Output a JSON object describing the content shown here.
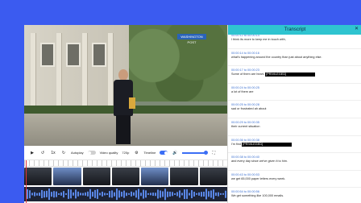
{
  "video": {
    "logo_text": "WASHINGTON POST"
  },
  "controls": {
    "speed": "1x",
    "autoplay_label": "Autoplay",
    "quality_label": "Video quality",
    "quality_value": "720p",
    "timeline_label": "Timeline"
  },
  "transcript": {
    "title": "Transcript",
    "segments": [
      {
        "time": "00:00:12 to 00:00:14",
        "text": "I think its more to keep me in touch with,",
        "privileged": ""
      },
      {
        "time": "00:00:14 to 00:00:16",
        "text": "what's happening around the country than just about anything else.",
        "privileged": ""
      },
      {
        "time": "00:00:17 to 00:00:23",
        "text": "Some of them are heart-",
        "privileged": "[PRIVILEGED]"
      },
      {
        "time": "00:00:24 to 00:00:25",
        "text": "a lot of them are",
        "privileged": ""
      },
      {
        "time": "00:00:25 to 00:00:28",
        "text": "sad or frustrated ah about",
        "privileged": ""
      },
      {
        "time": "00:00:29 to 00:00:35",
        "text": "their current situation",
        "privileged": ""
      },
      {
        "time": "00:00:36 to 00:00:38",
        "text": "I'm find",
        "privileged": "[PRIVILEGED]"
      },
      {
        "time": "00:00:38 to 00:00:40",
        "text": "and every day since we've given it to him.",
        "privileged": ""
      },
      {
        "time": "00:00:43 to 00:00:53",
        "text": "we get 65,000 paper letters every week.",
        "privileged": ""
      },
      {
        "time": "00:00:54 to 00:00:56",
        "text": "We get something like 100,000 emails.",
        "privileged": ""
      }
    ]
  }
}
